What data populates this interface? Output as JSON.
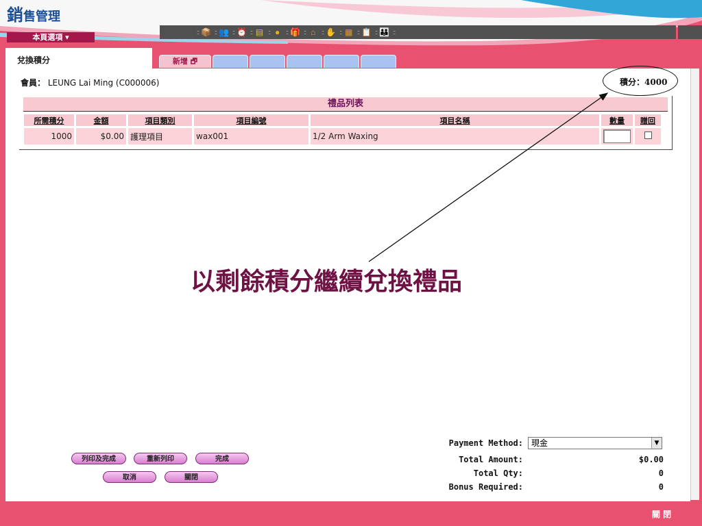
{
  "header": {
    "title_first": "銷",
    "title_rest": "售管理",
    "page_menu": "本頁選項 ▾"
  },
  "toolbar": {
    "icons": [
      {
        "name": "box-icon",
        "glyph": "📦",
        "color": "#c98a3a"
      },
      {
        "name": "people-icon",
        "glyph": "👥",
        "color": "#4a78b8"
      },
      {
        "name": "clock-icon",
        "glyph": "⏰",
        "color": "#e0a020"
      },
      {
        "name": "report-icon",
        "glyph": "▤",
        "color": "#d0c05a"
      },
      {
        "name": "coin-icon",
        "glyph": "●",
        "color": "#e8b020"
      },
      {
        "name": "gift-icon",
        "glyph": "🎁",
        "color": "#d04020"
      },
      {
        "name": "home-icon",
        "glyph": "⌂",
        "color": "#e0a050"
      },
      {
        "name": "hand-icon",
        "glyph": "✋",
        "color": "#e8b070"
      },
      {
        "name": "calculator-icon",
        "glyph": "▦",
        "color": "#e09a20"
      },
      {
        "name": "clipboard-icon",
        "glyph": "📋",
        "color": "#e0c070"
      },
      {
        "name": "group-icon",
        "glyph": "👪",
        "color": "#4a78b8"
      }
    ]
  },
  "panel": {
    "title": "兌換積分"
  },
  "tabs": [
    {
      "label": "新增 🗗"
    },
    {
      "label": ""
    },
    {
      "label": ""
    },
    {
      "label": ""
    },
    {
      "label": ""
    },
    {
      "label": ""
    }
  ],
  "member": {
    "label": "會員：",
    "value": "LEUNG Lai Ming (C000006)"
  },
  "points": {
    "label": "積分：",
    "value": "4000"
  },
  "gift_list": {
    "title": "禮品列表",
    "columns": [
      "所需積分",
      "金額",
      "項目類別",
      "項目編號",
      "項目名稱",
      "數量",
      "贈回"
    ],
    "rows": [
      {
        "points": "1000",
        "amount": "$0.00",
        "category": "護理項目",
        "code": "wax001",
        "name": "1/2 Arm Waxing"
      }
    ]
  },
  "annotation": "以剩餘積分繼續兌換禮品",
  "buttons": {
    "print_finish": "列印及完成",
    "reprint": "重新列印",
    "finish": "完成",
    "cancel": "取消",
    "close": "關閉"
  },
  "summary": {
    "payment_label": "Payment Method:",
    "payment_value": "現金",
    "total_amount_label": "Total Amount:",
    "total_amount": "$0.00",
    "total_qty_label": "Total Qty:",
    "total_qty": "0",
    "bonus_label": "Bonus Required:",
    "bonus": "0"
  },
  "footer": {
    "close": "關 閉"
  },
  "colors": {
    "brand": "#1b4f9c",
    "accent": "#e8516f",
    "menu": "#a3174b",
    "table_header": "#f9c9d1",
    "annotation": "#6e1244"
  }
}
